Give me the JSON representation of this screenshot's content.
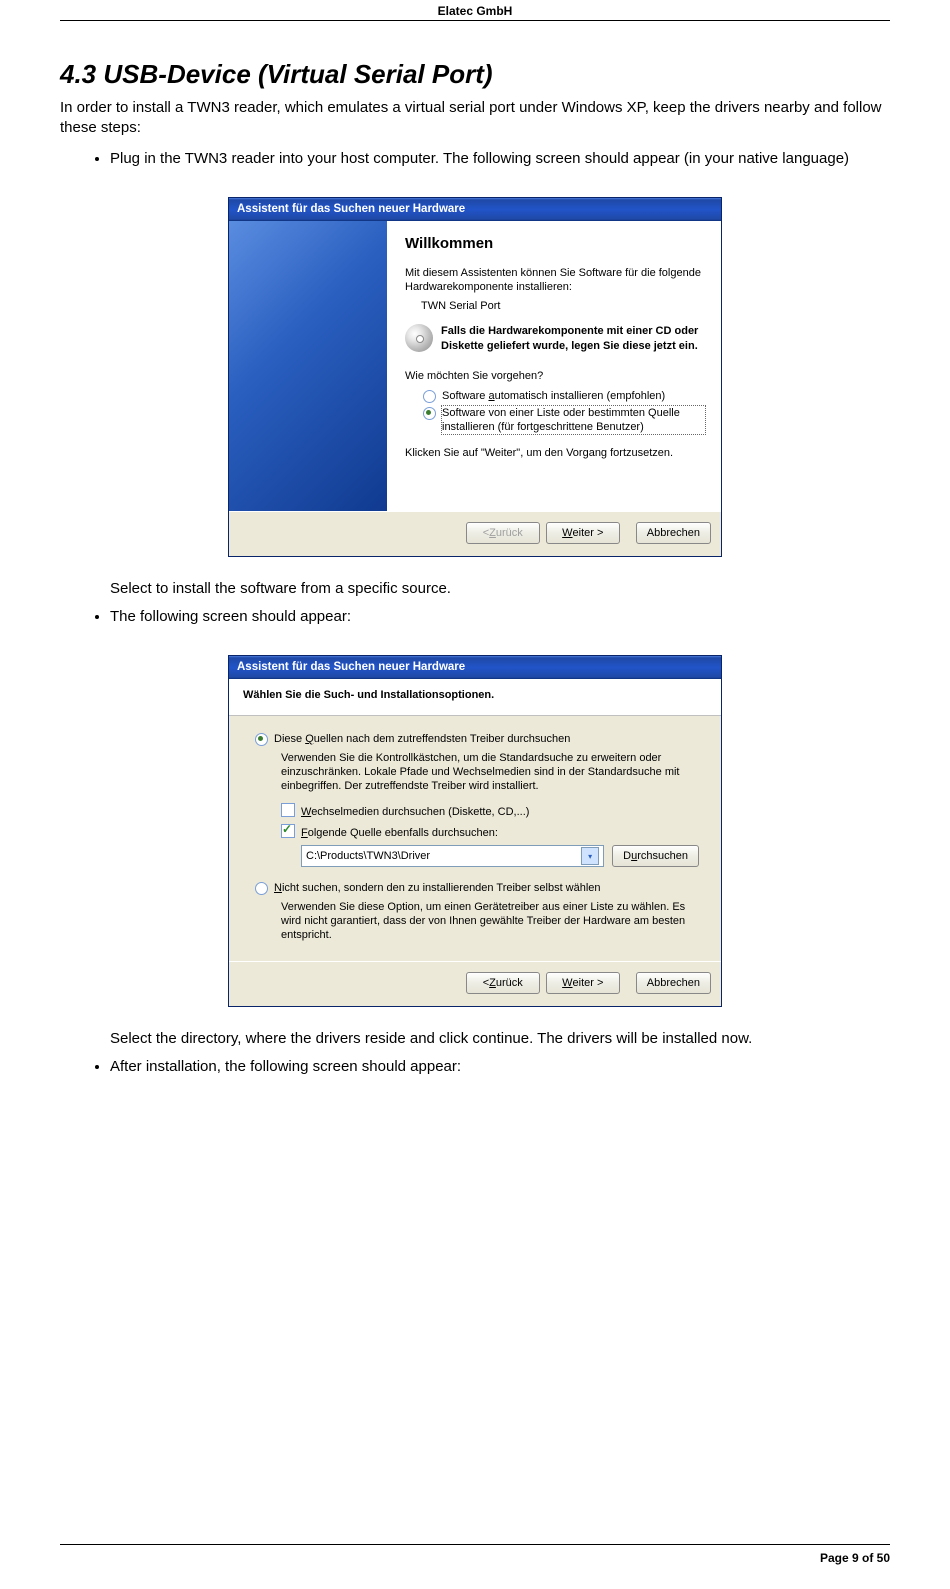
{
  "header": {
    "company": "Elatec GmbH"
  },
  "section": {
    "number": "4.3",
    "title": "USB-Device (Virtual Serial Port)",
    "intro": "In order to install a TWN3 reader, which emulates a virtual serial port under Windows XP, keep the drivers nearby and follow these steps:",
    "bullet1": "Plug in the TWN3 reader into your host computer. The following screen should appear (in your native language)",
    "after1": "Select to install the software from a specific source.",
    "bullet2": "The following screen should appear:",
    "after2": "Select the directory, where the drivers reside and click continue. The drivers will be installed now.",
    "bullet3": "After installation, the following screen should appear:"
  },
  "wizard1": {
    "title": "Assistent für das Suchen neuer Hardware",
    "heading": "Willkommen",
    "p1": "Mit diesem Assistenten können Sie Software für die folgende Hardwarekomponente installieren:",
    "device": "TWN Serial Port",
    "bold_hint": "Falls die Hardwarekomponente mit einer CD oder Diskette geliefert wurde, legen Sie diese jetzt ein.",
    "p2": "Wie möchten Sie vorgehen?",
    "radio1": "Software automatisch installieren (empfohlen)",
    "radio2": "Software von einer Liste oder bestimmten Quelle installieren (für fortgeschrittene Benutzer)",
    "p3": "Klicken Sie auf \"Weiter\", um den Vorgang fortzusetzen.",
    "btn_back": "< Zurück",
    "btn_next": "Weiter >",
    "btn_cancel": "Abbrechen"
  },
  "wizard2": {
    "title": "Assistent für das Suchen neuer Hardware",
    "header": "Wählen Sie die Such- und Installationsoptionen.",
    "radio1": "Diese Quellen nach dem zutreffendsten Treiber durchsuchen",
    "radio1_sub": "Verwenden Sie die Kontrollkästchen, um die Standardsuche zu erweitern oder einzuschränken. Lokale Pfade und Wechselmedien sind in der Standardsuche mit einbegriffen. Der zutreffendste Treiber wird installiert.",
    "check1": "Wechselmedien durchsuchen (Diskette, CD,...)",
    "check2": "Folgende Quelle ebenfalls durchsuchen:",
    "path": "C:\\Products\\TWN3\\Driver",
    "browse": "Durchsuchen",
    "radio2": "Nicht suchen, sondern den zu installierenden Treiber selbst wählen",
    "radio2_sub": "Verwenden Sie diese Option, um einen Gerätetreiber aus einer Liste zu wählen. Es wird nicht garantiert, dass der von Ihnen gewählte Treiber der Hardware am besten entspricht.",
    "btn_back": "< Zurück",
    "btn_next": "Weiter >",
    "btn_cancel": "Abbrechen"
  },
  "footer": {
    "page": "Page 9 of 50"
  }
}
